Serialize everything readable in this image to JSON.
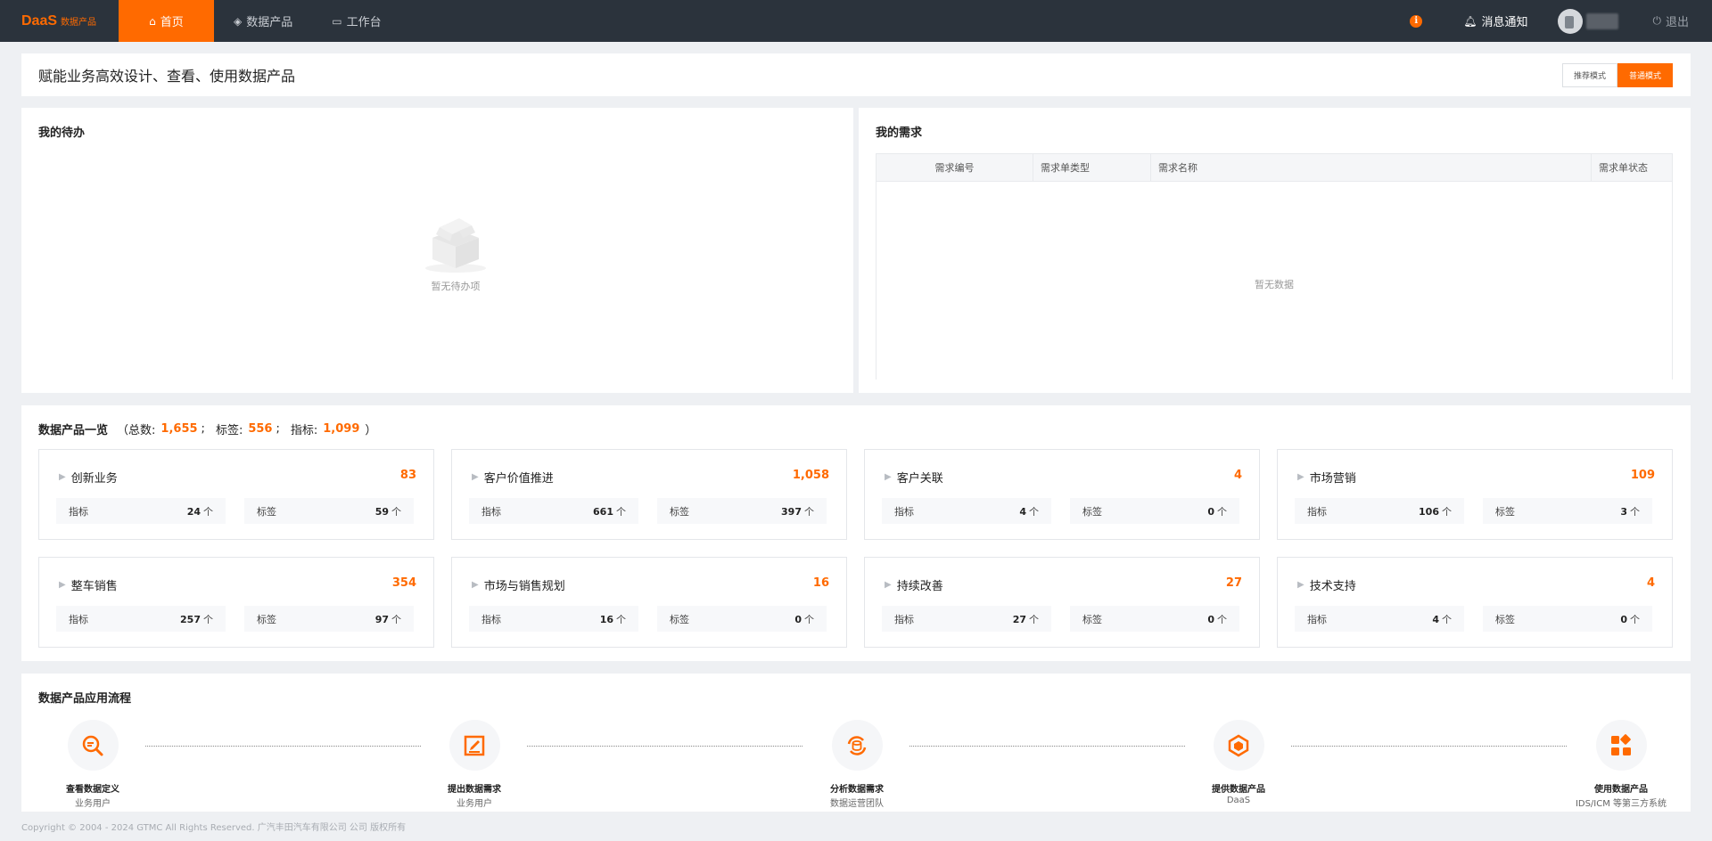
{
  "brand": {
    "main": "DaaS",
    "sub": "数据产品"
  },
  "nav": {
    "items": [
      {
        "label": "首页",
        "icon": "home-icon",
        "active": true
      },
      {
        "label": "数据产品",
        "icon": "layers-icon",
        "active": false
      },
      {
        "label": "工作台",
        "icon": "monitor-icon",
        "active": false
      }
    ],
    "info_badge": "i",
    "notifications_label": "消息通知",
    "logout_label": "退出"
  },
  "header": {
    "title": "赋能业务高效设计、查看、使用数据产品",
    "modes": [
      {
        "label": "推荐模式",
        "active": false
      },
      {
        "label": "普通模式",
        "active": true
      }
    ]
  },
  "todo": {
    "title": "我的待办",
    "empty_text": "暂无待办项"
  },
  "needs": {
    "title": "我的需求",
    "columns": [
      "需求编号",
      "需求单类型",
      "需求名称",
      "需求单状态"
    ],
    "empty_text": "暂无数据"
  },
  "products": {
    "title": "数据产品一览",
    "open_paren": "（",
    "close_paren": "）",
    "total_label": "总数:",
    "total": "1,655",
    "tag_label": "标签:",
    "tag_total": "556",
    "metric_label": "指标:",
    "metric_total": "1,099",
    "sep": ";",
    "stat_labels": {
      "metric": "指标",
      "tag": "标签"
    },
    "unit": "个",
    "cards": [
      {
        "name": "创新业务",
        "total": "83",
        "metric": "24",
        "tag": "59"
      },
      {
        "name": "客户价值推进",
        "total": "1,058",
        "metric": "661",
        "tag": "397"
      },
      {
        "name": "客户关联",
        "total": "4",
        "metric": "4",
        "tag": "0"
      },
      {
        "name": "市场营销",
        "total": "109",
        "metric": "106",
        "tag": "3"
      },
      {
        "name": "整车销售",
        "total": "354",
        "metric": "257",
        "tag": "97"
      },
      {
        "name": "市场与销售规划",
        "total": "16",
        "metric": "16",
        "tag": "0"
      },
      {
        "name": "持续改善",
        "total": "27",
        "metric": "27",
        "tag": "0"
      },
      {
        "name": "技术支持",
        "total": "4",
        "metric": "4",
        "tag": "0"
      }
    ]
  },
  "flow": {
    "title": "数据产品应用流程",
    "steps": [
      {
        "name": "查看数据定义",
        "sub": "业务用户",
        "icon": "search-data-icon"
      },
      {
        "name": "提出数据需求",
        "sub": "业务用户",
        "icon": "edit-request-icon"
      },
      {
        "name": "分析数据需求",
        "sub": "数据运营团队",
        "icon": "analyze-icon"
      },
      {
        "name": "提供数据产品",
        "sub": "DaaS",
        "icon": "provide-cube-icon"
      },
      {
        "name": "使用数据产品",
        "sub": "IDS/ICM 等第三方系统",
        "icon": "apps-grid-icon"
      }
    ]
  },
  "footer": {
    "copyright": "Copyright © 2004 - 2024 GTMC All Rights Reserved. 广汽丰田汽车有限公司 公司 版权所有"
  },
  "colors": {
    "accent": "#ff6a00",
    "nav_bg": "#2b333c",
    "page_bg": "#eef0f3"
  }
}
